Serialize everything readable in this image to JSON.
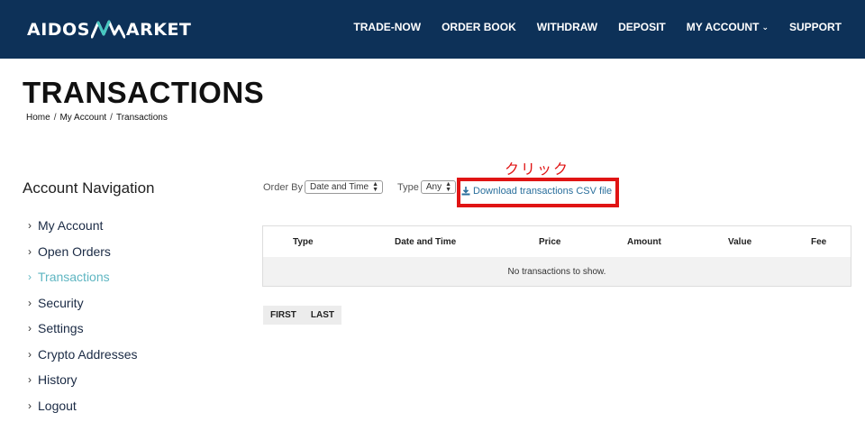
{
  "header": {
    "logo": {
      "left": "AIDOS",
      "right": "ARKET"
    },
    "nav": [
      {
        "label": "TRADE-NOW"
      },
      {
        "label": "ORDER BOOK"
      },
      {
        "label": "WITHDRAW"
      },
      {
        "label": "DEPOSIT"
      },
      {
        "label": "MY ACCOUNT"
      },
      {
        "label": "SUPPORT"
      }
    ]
  },
  "page": {
    "title": "TRANSACTIONS",
    "breadcrumb": [
      "Home",
      "My Account",
      "Transactions"
    ]
  },
  "sidebar": {
    "heading": "Account Navigation",
    "items": [
      {
        "label": "My Account"
      },
      {
        "label": "Open Orders"
      },
      {
        "label": "Transactions",
        "active": true
      },
      {
        "label": "Security"
      },
      {
        "label": "Settings"
      },
      {
        "label": "Crypto Addresses"
      },
      {
        "label": "History"
      },
      {
        "label": "Logout"
      }
    ]
  },
  "filters": {
    "order_by_label": "Order By",
    "order_by_value": "Date and Time",
    "type_label": "Type",
    "type_value": "Any",
    "download_label": "Download transactions CSV file"
  },
  "annotation": {
    "callout": "クリック",
    "color": "#e01414"
  },
  "table": {
    "columns": [
      "Type",
      "Date and Time",
      "Price",
      "Amount",
      "Value",
      "Fee"
    ],
    "empty_message": "No transactions to show."
  },
  "pager": {
    "first": "FIRST",
    "last": "LAST"
  },
  "colors": {
    "header_bg": "#0d3158",
    "active_link": "#5fb6c2",
    "link": "#2a6f9c"
  }
}
